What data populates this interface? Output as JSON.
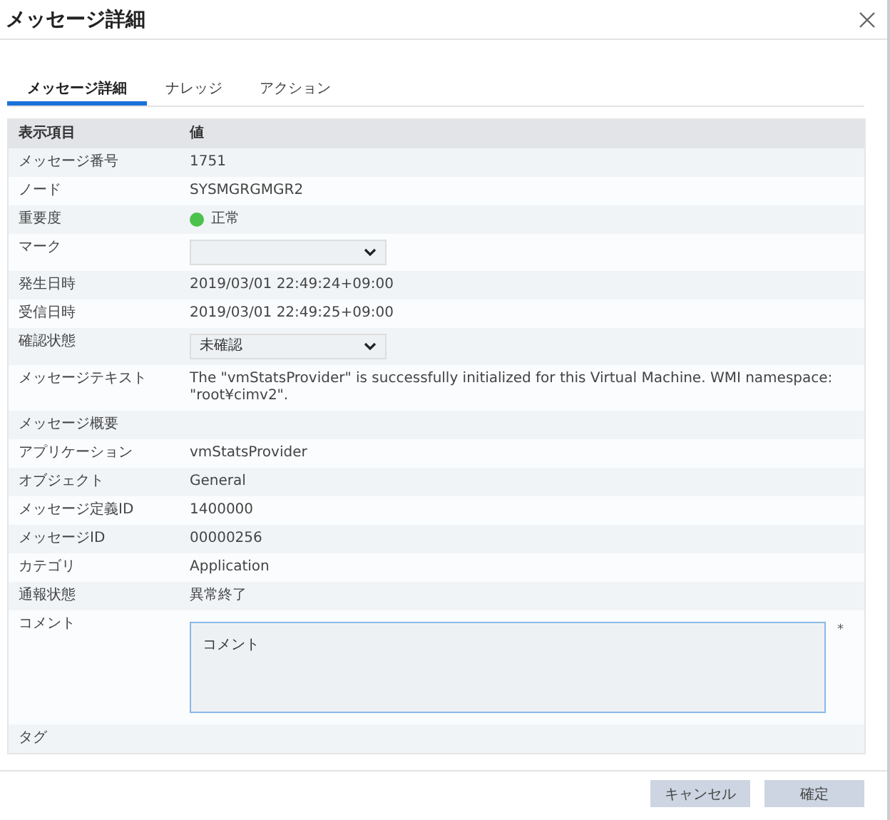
{
  "window": {
    "title": "メッセージ詳細"
  },
  "tabs": [
    {
      "label": "メッセージ詳細",
      "selected": true
    },
    {
      "label": "ナレッジ",
      "selected": false
    },
    {
      "label": "アクション",
      "selected": false
    }
  ],
  "table": {
    "columns": [
      "表示項目",
      "値"
    ],
    "rows": [
      {
        "kind": "text",
        "label": "メッセージ番号",
        "value": "1751"
      },
      {
        "kind": "text",
        "label": "ノード",
        "value": "SYSMGRGMGR2"
      },
      {
        "kind": "status",
        "label": "重要度",
        "value": "正常",
        "color": "#4cc24c"
      },
      {
        "kind": "select",
        "label": "マーク"
      },
      {
        "kind": "text",
        "label": "発生日時",
        "value": "2019/03/01 22:49:24+09:00"
      },
      {
        "kind": "text",
        "label": "受信日時",
        "value": "2019/03/01 22:49:25+09:00"
      },
      {
        "kind": "select",
        "label": "確認状態",
        "value": "未確認"
      },
      {
        "kind": "text",
        "label": "メッセージテキスト",
        "value": "The \"vmStatsProvider\" is successfully initialized for this Virtual Machine. WMI namespace: \"root¥cimv2\"."
      },
      {
        "kind": "text",
        "label": "メッセージ概要"
      },
      {
        "kind": "text",
        "label": "アプリケーション",
        "value": "vmStatsProvider"
      },
      {
        "kind": "text",
        "label": "オブジェクト",
        "value": "General"
      },
      {
        "kind": "text",
        "label": "メッセージ定義ID",
        "value": "1400000"
      },
      {
        "kind": "text",
        "label": "メッセージID",
        "value": "00000256"
      },
      {
        "kind": "text",
        "label": "カテゴリ",
        "value": "Application"
      },
      {
        "kind": "text",
        "label": "通報状態",
        "value": "異常終了"
      },
      {
        "kind": "textarea",
        "label": "コメント",
        "value": "コメント",
        "required_mark": "*"
      },
      {
        "kind": "text",
        "label": "タグ"
      }
    ]
  },
  "buttons": [
    "キャンセル",
    "確定"
  ]
}
